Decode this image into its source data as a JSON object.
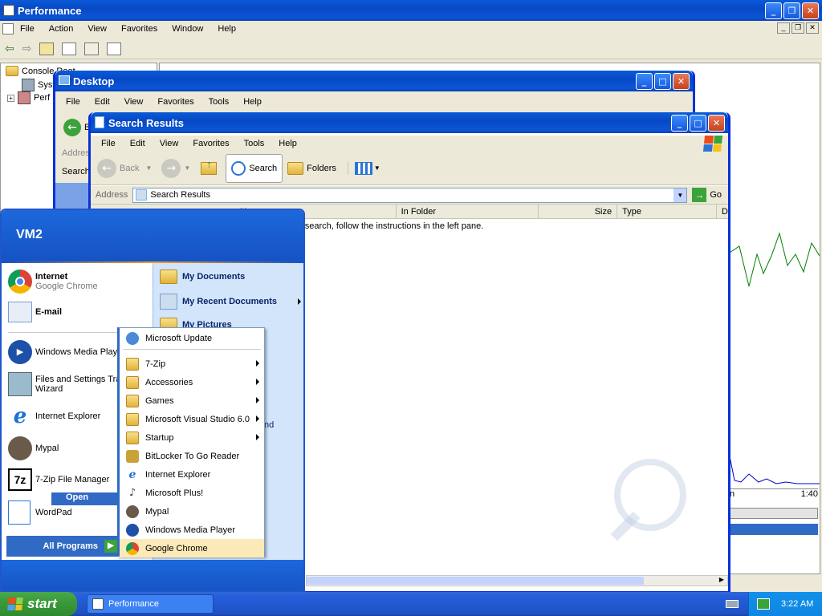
{
  "performance": {
    "title": "Performance",
    "menu": [
      "File",
      "Action",
      "View",
      "Favorites",
      "Window",
      "Help"
    ],
    "tree": [
      "Console Root",
      "Syst",
      "Perf"
    ],
    "graph_time": "1:40",
    "graph_label": "n"
  },
  "desktop_window": {
    "title": "Desktop",
    "menu": [
      "File",
      "Edit",
      "View",
      "Favorites",
      "Tools",
      "Help"
    ],
    "back_label": "B",
    "address_label": "Addres",
    "search_label": "Search"
  },
  "search_window": {
    "title": "Search Results",
    "menu": [
      "File",
      "Edit",
      "View",
      "Favorites",
      "Tools",
      "Help"
    ],
    "back_label": "Back",
    "search_label": "Search",
    "folders_label": "Folders",
    "address_label": "Address",
    "address_value": "Search Results",
    "go_label": "Go",
    "columns": [
      "N",
      "In Folder",
      "Size",
      "Type",
      "D"
    ],
    "message": "r search, follow the instructions in the left pane."
  },
  "start_menu": {
    "user": "VM2",
    "pinned": [
      {
        "title": "Internet",
        "subtitle": "Google Chrome"
      },
      {
        "title": "E-mail",
        "subtitle": ""
      }
    ],
    "recent": [
      "Windows Media Playe",
      "Files and Settings Tra",
      "Wizard",
      "Internet Explorer",
      "Mypal",
      "7-Zip File Manager",
      "WordPad"
    ],
    "open_label": "Open",
    "all_programs": "All Programs",
    "right_items": [
      "My Documents",
      "My Recent Documents",
      "My Pictures"
    ],
    "right_partial": "nd"
  },
  "programs_menu": {
    "items": [
      {
        "label": "Microsoft Update",
        "submenu": false
      },
      {
        "label": "7-Zip",
        "submenu": true
      },
      {
        "label": "Accessories",
        "submenu": true
      },
      {
        "label": "Games",
        "submenu": true
      },
      {
        "label": "Microsoft Visual Studio 6.0",
        "submenu": true
      },
      {
        "label": "Startup",
        "submenu": true
      },
      {
        "label": "BitLocker To Go Reader",
        "submenu": false
      },
      {
        "label": "Internet Explorer",
        "submenu": false
      },
      {
        "label": "Microsoft Plus!",
        "submenu": false
      },
      {
        "label": "Mypal",
        "submenu": false
      },
      {
        "label": "Windows Media Player",
        "submenu": false
      },
      {
        "label": "Google Chrome",
        "submenu": false
      }
    ],
    "highlighted_index": 11
  },
  "taskbar": {
    "start_label": "start",
    "task": "Performance",
    "clock": "3:22 AM"
  },
  "colors": {
    "xp_blue": "#0a5bd9",
    "taskbar": "#245edb",
    "start_green": "#3a9a3a",
    "highlight": "#fce9b8"
  }
}
